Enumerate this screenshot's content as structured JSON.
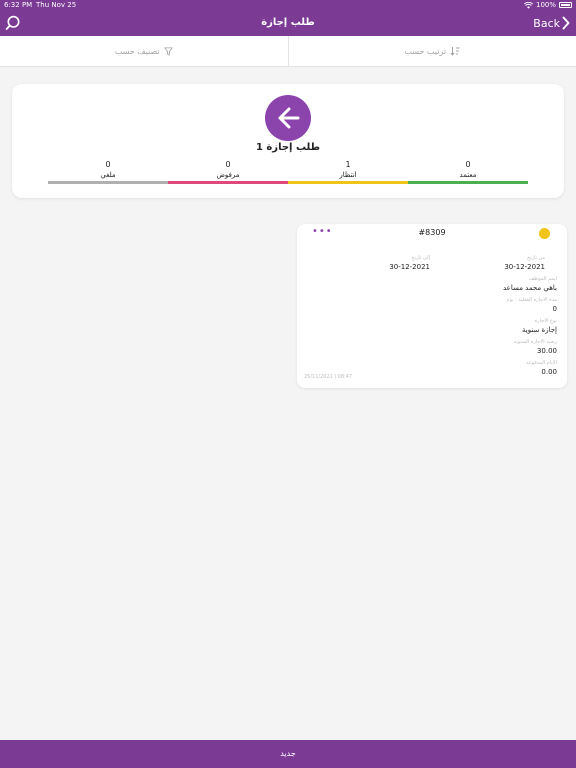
{
  "status_bar": {
    "time": "6:32 PM",
    "date": "Thu Nov 25",
    "battery": "100%"
  },
  "nav": {
    "title": "طلب إجازة",
    "back_label": "Back",
    "search_icon": "search-icon",
    "back_icon": "chevron-right-icon"
  },
  "filters": {
    "sort_label": "ترتيب حسب",
    "classify_label": "تصنيف حسب"
  },
  "summary": {
    "count_label": "1 طلب إجازة",
    "stats": [
      {
        "label": "معتمد",
        "value": "0",
        "color": "#4caf50"
      },
      {
        "label": "انتظار",
        "value": "1",
        "color": "#f0c419"
      },
      {
        "label": "مرفوض",
        "value": "0",
        "color": "#e0487a"
      },
      {
        "label": "ملغي",
        "value": "0",
        "color": "#b0b0b0"
      }
    ]
  },
  "leave_request": {
    "number": "#8309",
    "status_color": "#f0c419",
    "more_label": "•••",
    "from_label": "من تاريخ",
    "from_value": "30-12-2021",
    "to_label": "إلى تاريخ",
    "to_value": "30-12-2021",
    "employee_label": "اسم الموظف",
    "employee_value": "باهي محمد مساعد",
    "duration_label": "مدة الاجازة الفعلية : يوم",
    "duration_value": "0",
    "type_label": "نوع الاجازة",
    "type_value": "إجازة سنوية",
    "balance_label": "رصيد الاجازة السنوية",
    "balance_value": "30.00",
    "paid_days_label": "الايام المدفوعة",
    "paid_days_value": "0.00",
    "timestamp": "25/11/2021 | 08:47"
  },
  "bottom": {
    "new_label": "جديد"
  }
}
